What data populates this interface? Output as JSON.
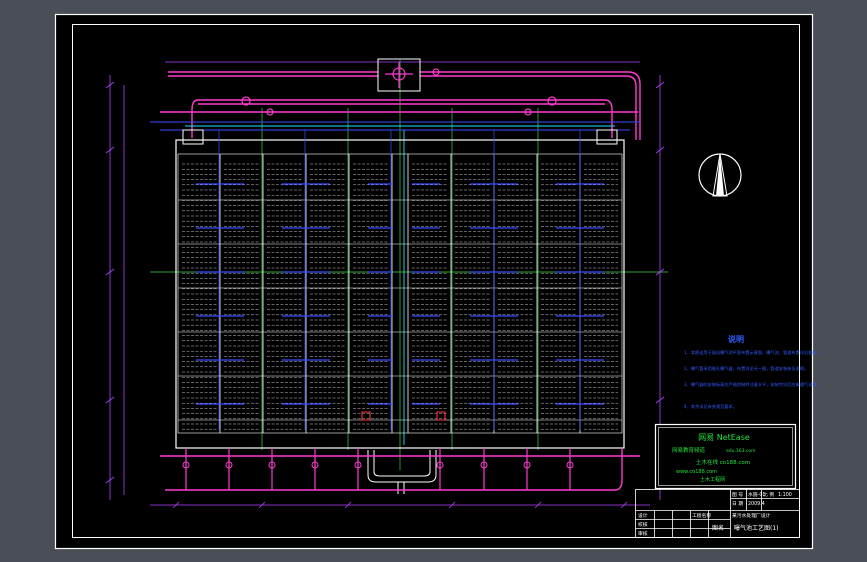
{
  "drawing": {
    "background_color": "#4a4e57",
    "paper_color": "#000000",
    "frame_color": "#ffffff",
    "colors": {
      "air_pipe": "#ff3ad0",
      "water_pipe": "#3a4dff",
      "dim_line": "#b040ff",
      "center_line": "#36d84a",
      "cyan": "#22e0ff",
      "yellow": "#ffe93b",
      "red": "#ff3b3b",
      "note_text": "#2f5cff",
      "logo_text": "#23e23c"
    }
  },
  "notes": {
    "title": "说明",
    "items": [
      "1、本图适用于鼓风曝气池平面布置示意图，曝气池、管道布置详见各图。",
      "2、曝气管采用微孔曝气器，布置详见另一图，管道安装参见说明。",
      "3、曝气器的安装标高应严格控制并注意水平，安装完毕后应做通气试验。",
      "4、其余详见有关规范要求。"
    ]
  },
  "logo": {
    "brand": "网易 NetEase",
    "line2": "网易教育频道",
    "url": "edu.163.com",
    "line4": "土木在线 co188.com",
    "line5": "www.co188.com",
    "line6": "土木工程网"
  },
  "title_block": {
    "left_labels": [
      "设计",
      "校核",
      "审核"
    ],
    "mid_labels": [
      "图 号",
      "日 期",
      "比 例"
    ],
    "values": [
      "水施-01",
      "2009.4",
      "1:100"
    ],
    "project_label": "工程名称",
    "project_value": "某污水处理厂设计",
    "drawing_label": "图名",
    "drawing_value": "曝气池工艺图(1)"
  }
}
